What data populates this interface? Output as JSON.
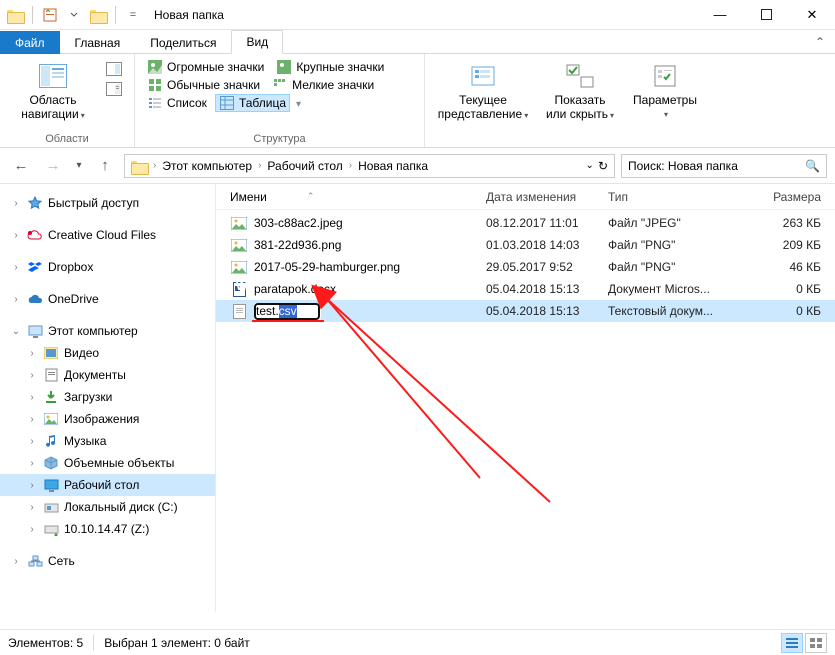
{
  "window_title": "Новая папка",
  "tabs": {
    "file": "Файл",
    "home": "Главная",
    "share": "Поделиться",
    "view": "Вид"
  },
  "ribbon": {
    "panes_group": "Области",
    "pane_btn": "Область\nнавигации",
    "layouts_group": "Структура",
    "layouts": {
      "huge": "Огромные значки",
      "large": "Крупные значки",
      "normal": "Обычные значки",
      "small": "Мелкие значки",
      "list": "Список",
      "table": "Таблица"
    },
    "current_view": "Текущее\nпредставление",
    "show_hide": "Показать\nили скрыть",
    "options": "Параметры"
  },
  "breadcrumbs": [
    "Этот компьютер",
    "Рабочий стол",
    "Новая папка"
  ],
  "search_placeholder": "Поиск: Новая папка",
  "nav": {
    "quick": "Быстрый доступ",
    "ccf": "Creative Cloud Files",
    "dropbox": "Dropbox",
    "onedrive": "OneDrive",
    "pc": "Этот компьютер",
    "video": "Видео",
    "docs": "Документы",
    "downloads": "Загрузки",
    "images": "Изображения",
    "music": "Музыка",
    "objects": "Объемные объекты",
    "desktop": "Рабочий стол",
    "disk_c": "Локальный диск (C:)",
    "disk_z": "10.10.14.47 (Z:)",
    "network": "Сеть"
  },
  "columns": {
    "name": "Имени",
    "date": "Дата изменения",
    "type": "Тип",
    "size": "Размера"
  },
  "files": [
    {
      "name": "303-c88ac2.jpeg",
      "date": "08.12.2017 11:01",
      "type": "Файл \"JPEG\"",
      "size": "263 КБ",
      "icon": "img"
    },
    {
      "name": "381-22d936.png",
      "date": "01.03.2018 14:03",
      "type": "Файл \"PNG\"",
      "size": "209 КБ",
      "icon": "img"
    },
    {
      "name": "2017-05-29-hamburger.png",
      "date": "29.05.2017 9:52",
      "type": "Файл \"PNG\"",
      "size": "46 КБ",
      "icon": "img"
    },
    {
      "name": "paratapok.docx",
      "date": "05.04.2018 15:13",
      "type": "Документ Micros...",
      "size": "0 КБ",
      "icon": "doc"
    },
    {
      "name": "test.csv",
      "date": "05.04.2018 15:13",
      "type": "Текстовый докум...",
      "size": "0 КБ",
      "icon": "txt",
      "editing": true
    }
  ],
  "status": {
    "items": "Элементов: 5",
    "selected": "Выбран 1 элемент: 0 байт"
  }
}
